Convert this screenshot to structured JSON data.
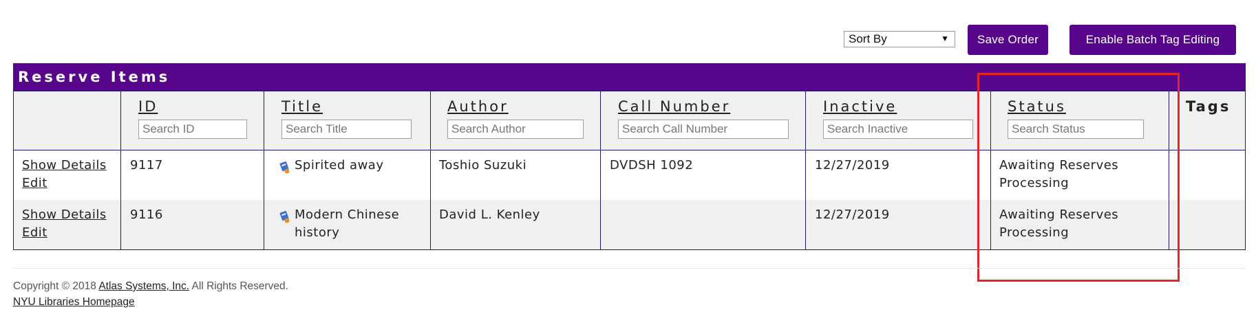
{
  "toolbar": {
    "sort_select_value": "Sort By",
    "save_order_label": "Save Order",
    "batch_tag_label": "Enable Batch Tag Editing"
  },
  "table": {
    "caption": "Reserve Items",
    "columns": [
      {
        "label": "ID",
        "placeholder": "Search ID"
      },
      {
        "label": "Title",
        "placeholder": "Search Title"
      },
      {
        "label": "Author",
        "placeholder": "Search Author"
      },
      {
        "label": "Call Number",
        "placeholder": "Search Call Number"
      },
      {
        "label": "Inactive",
        "placeholder": "Search Inactive"
      },
      {
        "label": "Status",
        "placeholder": "Search Status"
      },
      {
        "label": "Tags"
      }
    ],
    "rows": [
      {
        "show_details": "Show Details",
        "edit": "Edit",
        "id": "9117",
        "title": "Spirited away",
        "author": "Toshio Suzuki",
        "call_number": "DVDSH 1092",
        "inactive": "12/27/2019",
        "status_line1": "Awaiting Reserves",
        "status_line2": "Processing",
        "tags": ""
      },
      {
        "show_details": "Show Details",
        "edit": "Edit",
        "id": "9116",
        "title_line1": "Modern Chinese",
        "title_line2": "history",
        "author": "David L. Kenley",
        "call_number": "",
        "inactive": "12/27/2019",
        "status_line1": "Awaiting Reserves",
        "status_line2": "Processing",
        "tags": ""
      }
    ]
  },
  "footer": {
    "copyright_prefix": "Copyright © 2018 ",
    "company_link": "Atlas Systems, Inc.",
    "rights": " All Rights Reserved.",
    "homepage_link": "NYU Libraries Homepage"
  },
  "colors": {
    "brand_purple": "#57068c",
    "table_border": "#1c1a6e",
    "highlight_red": "#e3242b",
    "row_alt": "#f0f0f0"
  },
  "icons": {
    "title_type_icon": "document-media-icon",
    "select_arrow": "chevron-down-icon"
  }
}
